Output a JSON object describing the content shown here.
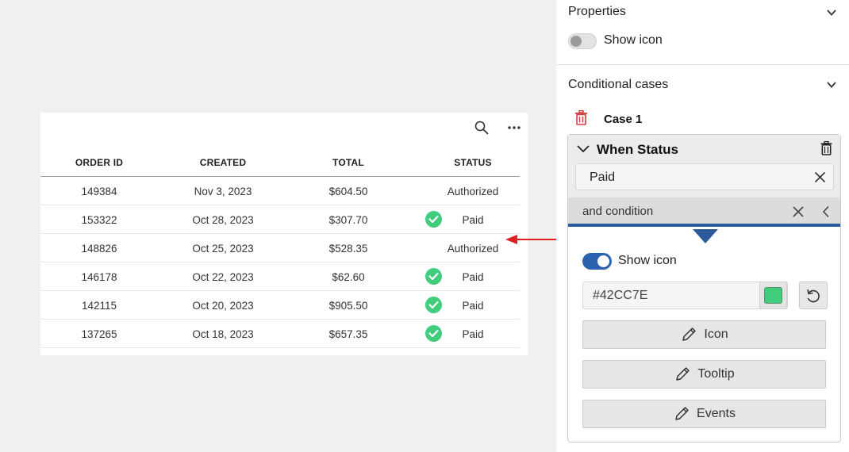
{
  "table": {
    "columns": [
      "ORDER ID",
      "CREATED",
      "TOTAL",
      "STATUS"
    ],
    "rows": [
      {
        "order_id": "149384",
        "created": "Nov 3, 2023",
        "total": "$604.50",
        "status": "Authorized",
        "icon": false
      },
      {
        "order_id": "153322",
        "created": "Oct 28, 2023",
        "total": "$307.70",
        "status": "Paid",
        "icon": true
      },
      {
        "order_id": "148826",
        "created": "Oct 25, 2023",
        "total": "$528.35",
        "status": "Authorized",
        "icon": false
      },
      {
        "order_id": "146178",
        "created": "Oct 22, 2023",
        "total": "$62.60",
        "status": "Paid",
        "icon": true
      },
      {
        "order_id": "142115",
        "created": "Oct 20, 2023",
        "total": "$905.50",
        "status": "Paid",
        "icon": true
      },
      {
        "order_id": "137265",
        "created": "Oct 18, 2023",
        "total": "$657.35",
        "status": "Paid",
        "icon": true
      }
    ],
    "toolbar_icons": [
      "search-icon",
      "more-icon"
    ]
  },
  "panel": {
    "properties_title": "Properties",
    "show_icon_label": "Show icon",
    "show_icon_enabled": false,
    "conditional_title": "Conditional cases",
    "case_label": "Case 1",
    "when_title": "When Status",
    "when_value": "Paid",
    "condition_text": "and  condition",
    "case_show_icon_label": "Show icon",
    "case_show_icon_enabled": true,
    "icon_color": "#42CC7E",
    "buttons": {
      "icon": "Icon",
      "tooltip": "Tooltip",
      "events": "Events"
    }
  },
  "colors": {
    "accent_blue": "#2B5C99",
    "delete_red": "#D63B3B",
    "arrow_red": "#E02020",
    "check_green": "#42CC7E"
  }
}
